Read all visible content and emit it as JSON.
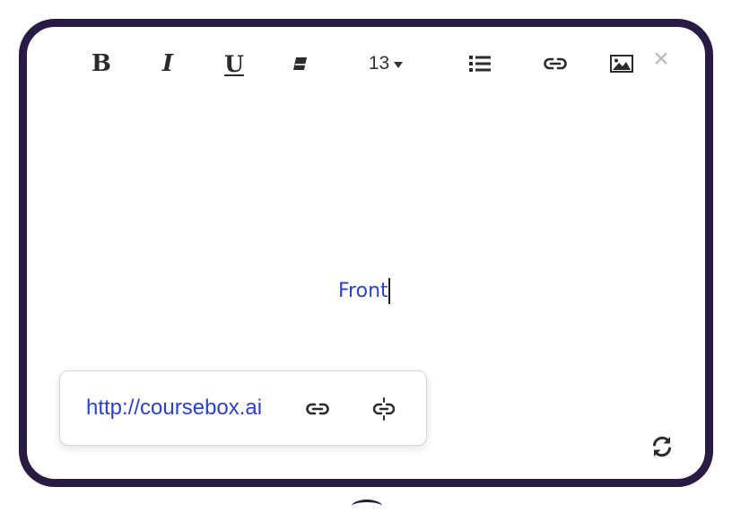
{
  "toolbar": {
    "bold_label": "B",
    "italic_label": "I",
    "underline_label": "U",
    "eraser_icon": "eraser-icon",
    "font_size": "13",
    "list_icon": "bulleted-list-icon",
    "link_icon": "link-icon",
    "image_icon": "image-icon",
    "close_label": "×"
  },
  "editor": {
    "text": "Front"
  },
  "link_popup": {
    "url": "http://coursebox.ai",
    "edit_icon": "link-icon",
    "unlink_icon": "unlink-icon"
  },
  "card": {
    "refresh_icon": "refresh-icon"
  },
  "colors": {
    "frame": "#2a1b45",
    "link_text": "#2b3fd6",
    "icon": "#2b2b2b",
    "close": "#b9b9b9"
  }
}
